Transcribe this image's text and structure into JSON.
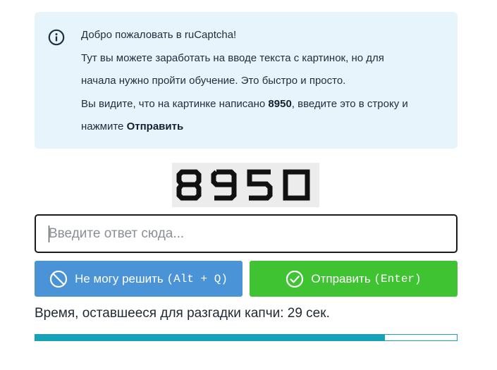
{
  "info": {
    "icon": "info-icon",
    "line1": "Добро пожаловать в ruCaptcha!",
    "line2": "Тут вы можете заработать на вводе текста с картинок, но для",
    "line3": "начала нужно пройти обучение. Это быстро и просто.",
    "line4_pre": "Вы видите, что на картинке написано ",
    "line4_code": "8950",
    "line4_post": ", введите это в строку и",
    "line5_pre": "нажмите ",
    "line5_bold": "Отправить"
  },
  "captcha": {
    "text": "8950"
  },
  "answer": {
    "value": "",
    "placeholder": "Введите ответ сюда..."
  },
  "buttons": {
    "skip_label": "Не могу решить",
    "skip_shortcut": "(Alt + Q)",
    "skip_icon": "prohibited-icon",
    "submit_label": "Отправить",
    "submit_shortcut": "(Enter)",
    "submit_icon": "check-circle-icon"
  },
  "timer": {
    "text": "Время, оставшееся для разгадки капчи: 29 сек.",
    "remaining_fraction": 0.83
  },
  "colors": {
    "info_bg": "#e8f4fb",
    "skip_button": "#4a93d6",
    "submit_button": "#3fc332",
    "progress": "#17a2b8"
  }
}
